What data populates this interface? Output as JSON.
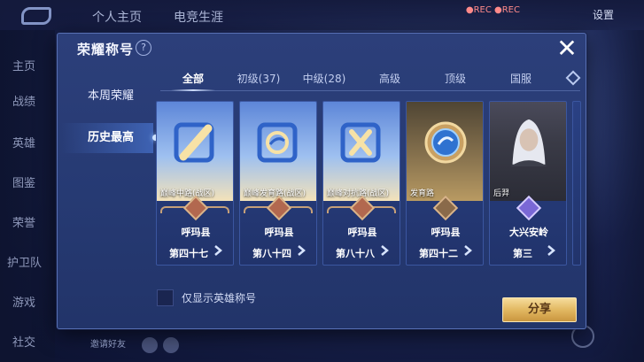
{
  "background": {
    "tabs": [
      "个人主页",
      "电竞生涯"
    ],
    "settings_label": "设置",
    "record_label": "●REC ●REC",
    "left_nav": [
      "主页",
      "战绩",
      "英雄",
      "图鉴",
      "荣誉",
      "护卫队",
      "游戏",
      "社交"
    ],
    "chat_placeholder": "邀请好友"
  },
  "modal": {
    "title": "荣耀称号",
    "help_icon": "question-icon",
    "close_icon": "close-icon",
    "side_items": [
      {
        "label": "本周荣耀",
        "active": false
      },
      {
        "label": "历史最高",
        "active": true
      }
    ],
    "tabs": [
      {
        "label": "全部",
        "active": true
      },
      {
        "label": "初级(37)",
        "active": false
      },
      {
        "label": "中级(28)",
        "active": false
      },
      {
        "label": "高级",
        "active": false
      },
      {
        "label": "顶级",
        "active": false
      },
      {
        "label": "国服",
        "active": false
      }
    ],
    "cards": [
      {
        "title": "巅峰中路(战区)",
        "badge_number": "4",
        "region": "呼玛县",
        "rank": "第四十七",
        "icon": "sword-icon"
      },
      {
        "title": "巅峰发育路(战区)",
        "badge_number": "3",
        "region": "呼玛县",
        "rank": "第八十四",
        "icon": "target-icon"
      },
      {
        "title": "巅峰对抗路(战区)",
        "badge_number": "4",
        "region": "呼玛县",
        "rank": "第八十八",
        "icon": "crossed-swords-icon"
      },
      {
        "title": "发育路",
        "badge_number": "",
        "region": "呼玛县",
        "rank": "第四十二",
        "icon": "emblem-icon"
      },
      {
        "title": "后羿",
        "badge_number": "",
        "region": "大兴安岭",
        "rank": "第三",
        "icon": "hero-portrait"
      }
    ],
    "checkbox_label": "仅显示英雄称号",
    "share_label": "分享"
  }
}
